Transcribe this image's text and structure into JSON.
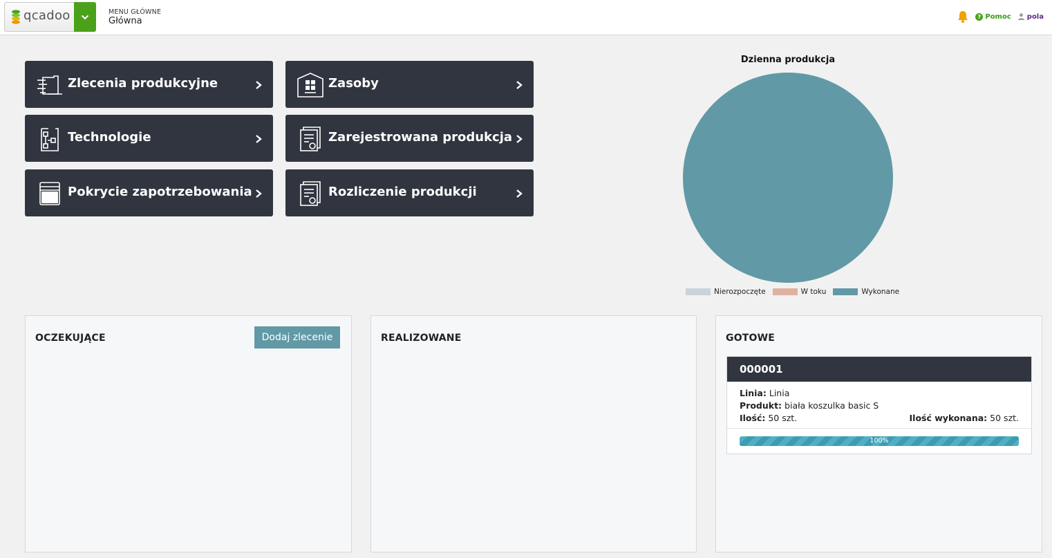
{
  "header": {
    "logo_text": "qcadoo",
    "menu_caption": "MENU GŁÓWNE",
    "menu_current": "Główna",
    "help_label": "Pomoc",
    "user_label": "pola"
  },
  "tiles": [
    {
      "label": "Zlecenia produkcyjne",
      "icon": "production-orders-icon"
    },
    {
      "label": "Zasoby",
      "icon": "resources-icon"
    },
    {
      "label": "Technologie",
      "icon": "technologies-icon"
    },
    {
      "label": "Zarejestrowana produkcja",
      "icon": "registered-production-icon"
    },
    {
      "label": "Pokrycie zapotrzebowania",
      "icon": "demand-coverage-icon"
    },
    {
      "label": "Rozliczenie produkcji",
      "icon": "production-settlement-icon"
    }
  ],
  "chart_data": {
    "type": "pie",
    "title": "Dzienna produkcja",
    "categories": [
      "Nierozpoczęte",
      "W toku",
      "Wykonane"
    ],
    "values": [
      0,
      0,
      1
    ],
    "colors": [
      "#c9d3dc",
      "#dfb1a0",
      "#6299a6"
    ],
    "legend": "bottom"
  },
  "columns": {
    "pending": {
      "title": "OCZEKUJĄCE",
      "add_button": "Dodaj zlecenie"
    },
    "in_progress": {
      "title": "REALIZOWANE"
    },
    "done": {
      "title": "GOTOWE",
      "orders": [
        {
          "number": "000001",
          "line_label": "Linia:",
          "line_value": "Linia",
          "product_label": "Produkt:",
          "product_value": "biała koszulka basic S",
          "qty_label": "Ilość:",
          "qty_value": "50 szt.",
          "qty_done_label": "Ilość wykonana:",
          "qty_done_value": "50 szt.",
          "progress_text": "100%",
          "progress": 1.0
        }
      ]
    }
  }
}
